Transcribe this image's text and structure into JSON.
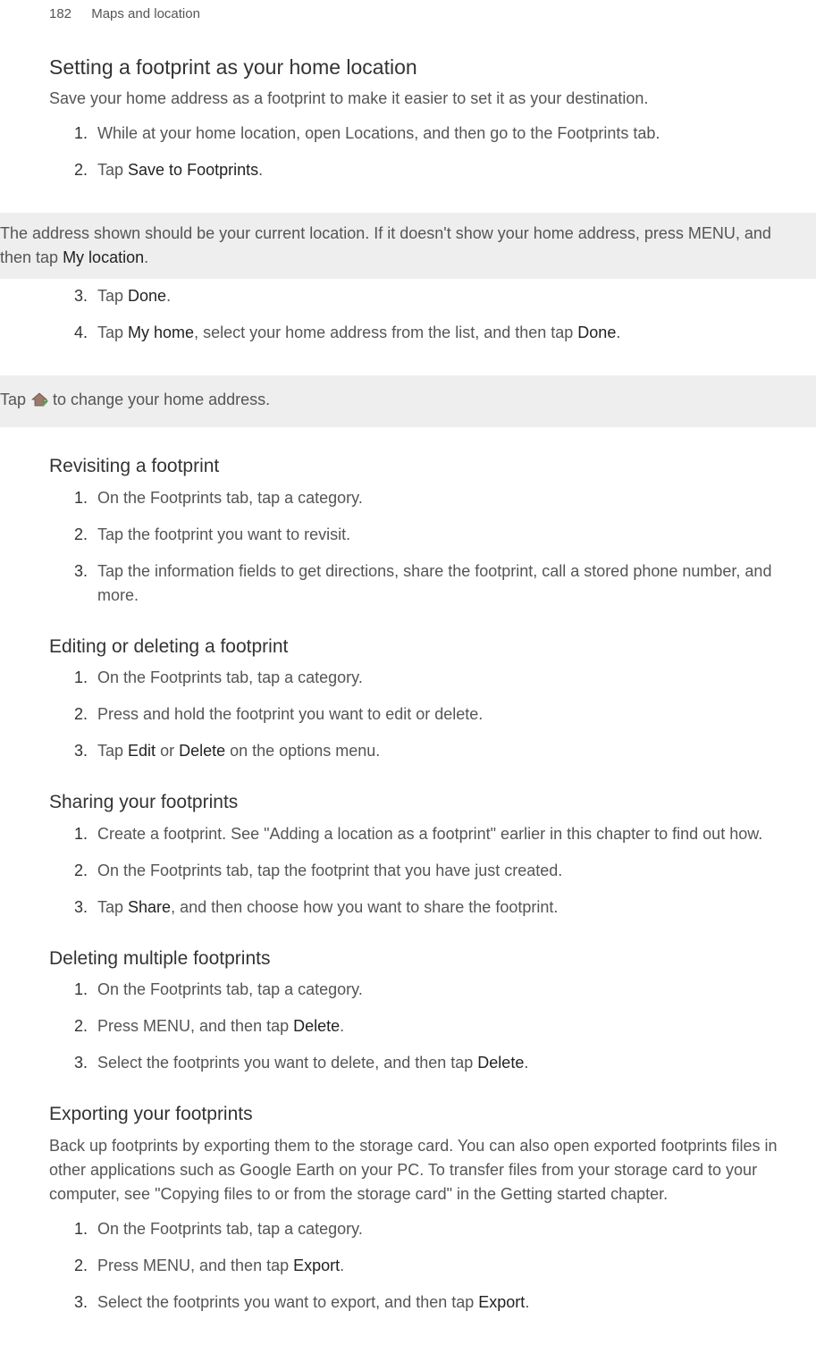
{
  "header": {
    "page_number": "182",
    "section": "Maps and location"
  },
  "s1": {
    "title": "Setting a footprint as your home location",
    "intro": "Save your home address as a footprint to make it easier to set it as your destination.",
    "step1": "While at your home location, open Locations, and then go to the Footprints tab.",
    "step2_a": "Tap ",
    "step2_b": "Save to Footprints",
    "step2_c": ".",
    "note_a": "The address shown should be your current location. If it doesn't show your home address, press MENU, and then tap ",
    "note_b": "My location",
    "note_c": ".",
    "step3_a": "Tap ",
    "step3_b": "Done",
    "step3_c": ".",
    "step4_a": "Tap ",
    "step4_b": "My home",
    "step4_c": ", select your home address from the list, and then tap ",
    "step4_d": "Done",
    "step4_e": ".",
    "tip_a": "Tap ",
    "tip_b": " to change your home address."
  },
  "s2": {
    "title": "Revisiting a footprint",
    "step1": "On the Footprints tab, tap a category.",
    "step2": "Tap the footprint you want to revisit.",
    "step3": "Tap the information fields to get directions, share the footprint, call a stored phone number, and more."
  },
  "s3": {
    "title": "Editing or deleting a footprint",
    "step1": "On the Footprints tab, tap a category.",
    "step2": "Press and hold the footprint you want to edit or delete.",
    "step3_a": "Tap ",
    "step3_b": "Edit",
    "step3_c": " or ",
    "step3_d": "Delete",
    "step3_e": " on the options menu."
  },
  "s4": {
    "title": "Sharing your footprints",
    "step1": "Create a footprint. See \"Adding a location as a footprint\" earlier in this chapter to find out how.",
    "step2": "On the Footprints tab, tap the footprint that you have just created.",
    "step3_a": "Tap ",
    "step3_b": "Share",
    "step3_c": ", and then choose how you want to share the footprint."
  },
  "s5": {
    "title": "Deleting multiple footprints",
    "step1": "On the Footprints tab, tap a category.",
    "step2_a": "Press MENU, and then tap ",
    "step2_b": "Delete",
    "step2_c": ".",
    "step3_a": "Select the footprints you want to delete, and then tap ",
    "step3_b": "Delete",
    "step3_c": "."
  },
  "s6": {
    "title": "Exporting your footprints",
    "intro": "Back up footprints by exporting them to the storage card. You can also open exported footprints files in other applications such as Google Earth on your PC. To transfer files from your storage card to your computer, see \"Copying files to or from the storage card\" in the Getting started chapter.",
    "step1": "On the Footprints tab, tap a category.",
    "step2_a": "Press MENU, and then tap ",
    "step2_b": "Export",
    "step2_c": ".",
    "step3_a": "Select the footprints you want to export, and then tap ",
    "step3_b": "Export",
    "step3_c": "."
  }
}
